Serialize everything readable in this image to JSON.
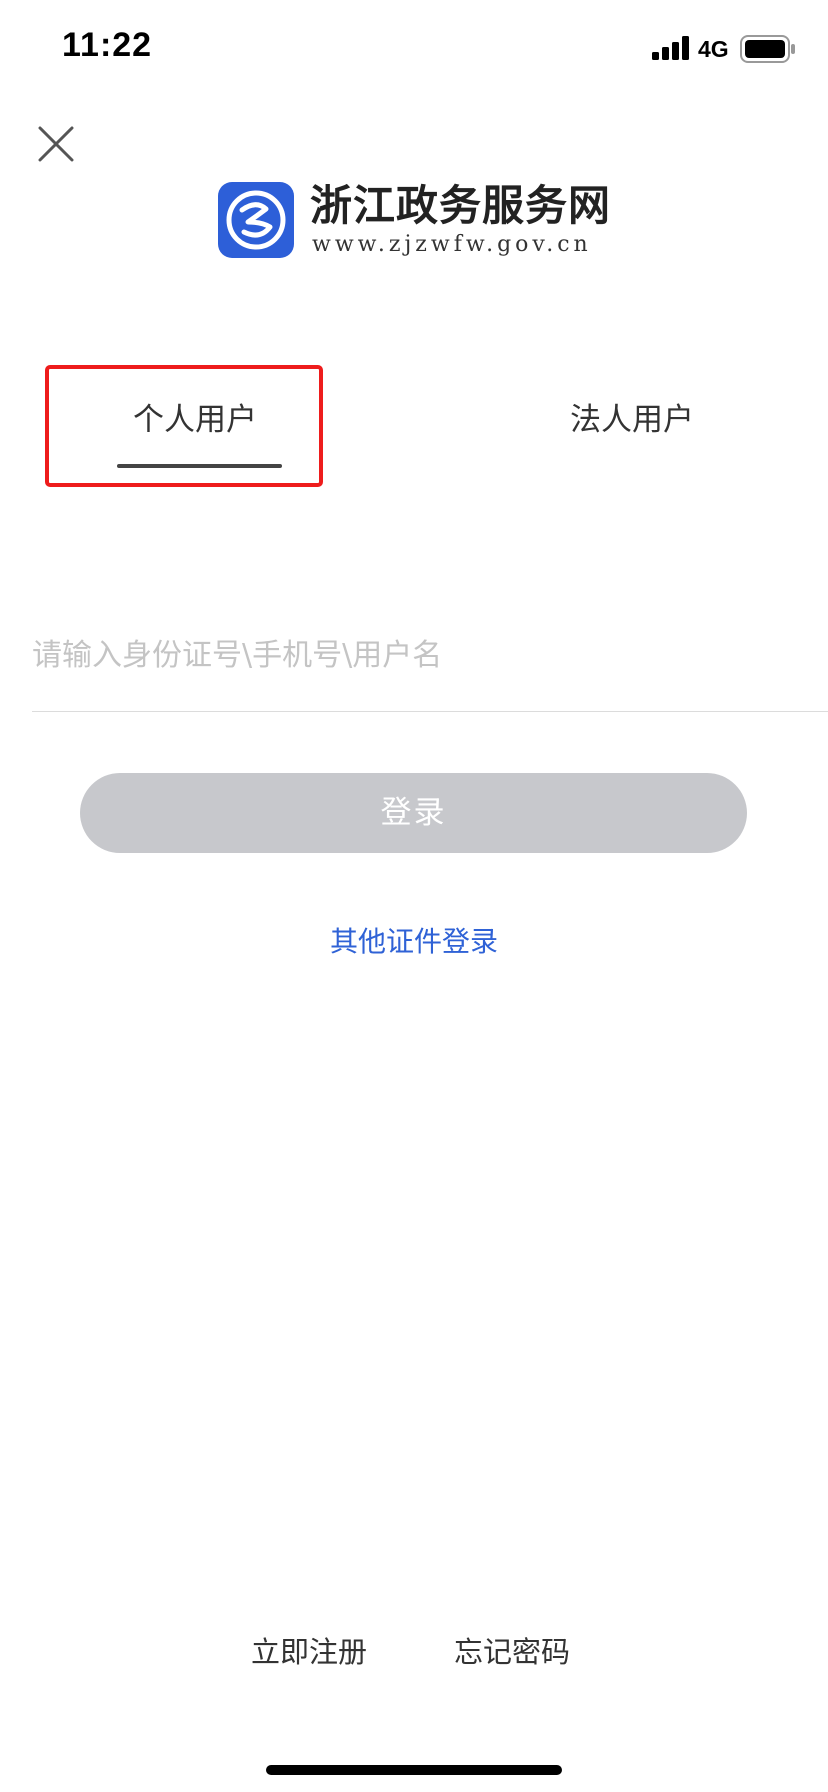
{
  "status_bar": {
    "time": "11:22",
    "network": "4G",
    "signal_icon": "cellular-signal-icon",
    "battery_icon": "battery-icon"
  },
  "header": {
    "close_icon": "close-icon"
  },
  "logo": {
    "title": "浙江政务服务网",
    "url": "www.zjzwfw.gov.cn",
    "brand_color": "#2d5fd8"
  },
  "tabs": [
    {
      "label": "个人用户",
      "active": true
    },
    {
      "label": "法人用户",
      "active": false
    }
  ],
  "highlight_color": "#ee1c1c",
  "form": {
    "account_value": "",
    "account_placeholder": "请输入身份证号\\手机号\\用户名",
    "login_label": "登录",
    "login_button_color": "#c7c8cc",
    "other_login_label": "其他证件登录",
    "link_color": "#2f62d6"
  },
  "footer": {
    "register_label": "立即注册",
    "forgot_label": "忘记密码"
  }
}
